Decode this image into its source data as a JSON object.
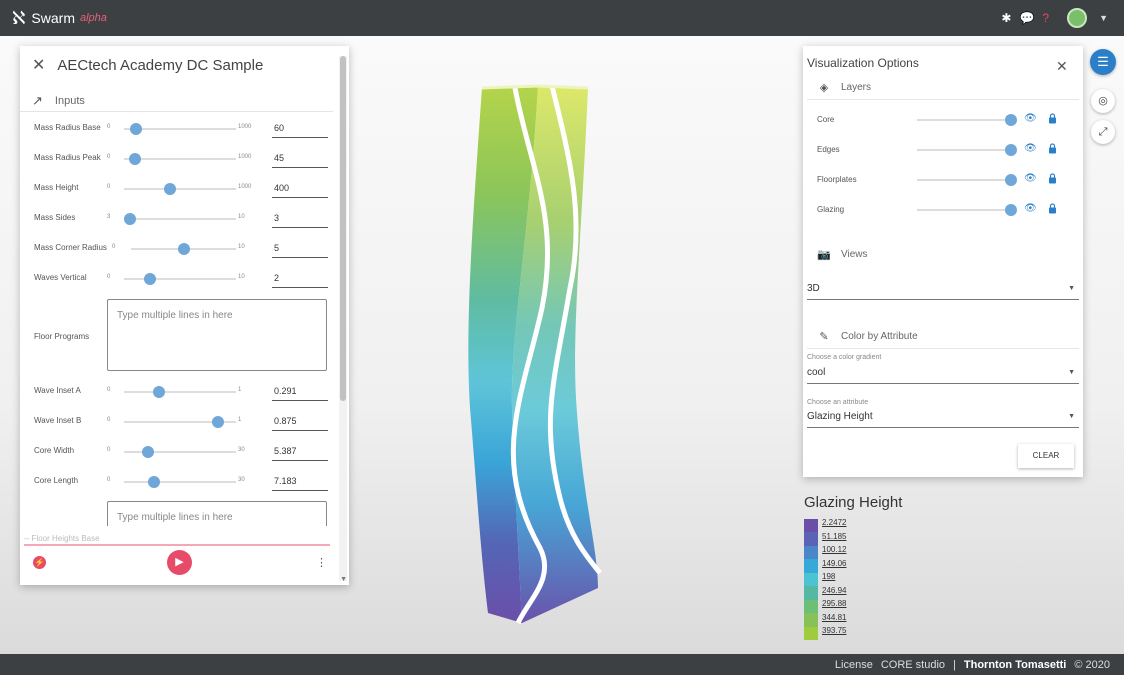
{
  "app": {
    "name": "Swarm",
    "tag": "alpha"
  },
  "footer": {
    "license": "License",
    "core": "CORE studio",
    "sep": "|",
    "brand": "Thornton Tomasetti",
    "copyright": "© 2020"
  },
  "left_panel": {
    "title": "AECtech Academy DC Sample",
    "section": "Inputs",
    "params": [
      {
        "name": "Mass Radius Base",
        "min": "0",
        "max": "1000",
        "value": "60",
        "fraction": 0.06
      },
      {
        "name": "Mass Radius Peak",
        "min": "0",
        "max": "1000",
        "value": "45",
        "fraction": 0.045
      },
      {
        "name": "Mass Height",
        "min": "0",
        "max": "1000",
        "value": "400",
        "fraction": 0.4
      },
      {
        "name": "Mass Sides",
        "min": "3",
        "max": "10",
        "value": "3",
        "fraction": 0.0
      },
      {
        "name": "Mass Corner Radius",
        "min": "0",
        "max": "10",
        "value": "5",
        "fraction": 0.5
      },
      {
        "name": "Waves Vertical",
        "min": "0",
        "max": "10",
        "value": "2",
        "fraction": 0.2
      },
      {
        "name": "Wave Inset A",
        "min": "0",
        "max": "1",
        "value": "0.291",
        "fraction": 0.291
      },
      {
        "name": "Wave Inset B",
        "min": "0",
        "max": "1",
        "value": "0.875",
        "fraction": 0.875
      },
      {
        "name": "Core Width",
        "min": "0",
        "max": "30",
        "value": "5.387",
        "fraction": 0.18
      },
      {
        "name": "Core Length",
        "min": "0",
        "max": "30",
        "value": "7.183",
        "fraction": 0.24
      }
    ],
    "floor_programs": {
      "label": "Floor Programs",
      "placeholder": "Type multiple lines in here"
    },
    "floor_heights": {
      "placeholder": "Type multiple lines in here",
      "ghost_label": "-- Floor Heights Base"
    }
  },
  "viz": {
    "title": "Visualization Options",
    "layers_title": "Layers",
    "layers": [
      "Core",
      "Edges",
      "Floorplates",
      "Glazing"
    ],
    "views_title": "Views",
    "view_value": "3D",
    "color_title": "Color by Attribute",
    "gradient_label": "Choose a color gradient",
    "gradient_value": "cool",
    "attribute_label": "Choose an attribute",
    "attribute_value": "Glazing Height",
    "clear_label": "CLEAR"
  },
  "legend": {
    "title": "Glazing Height",
    "values": [
      "2.2472",
      "51.185",
      "100.12",
      "149.06",
      "198",
      "246.94",
      "295.88",
      "344.81",
      "393.75"
    ],
    "colors": [
      "#6a4ea8",
      "#5b63b6",
      "#4a86c8",
      "#36a9d6",
      "#4cc3d2",
      "#55b8a2",
      "#6bbf76",
      "#86c257",
      "#9fcb3f"
    ]
  },
  "icons": {
    "logo": "swarm-logo-icon",
    "snow": "snowflake-icon",
    "chat": "chat-icon",
    "help": "help-icon",
    "menu": "menu-icon",
    "target": "locate-icon",
    "expand": "expand-icon"
  }
}
